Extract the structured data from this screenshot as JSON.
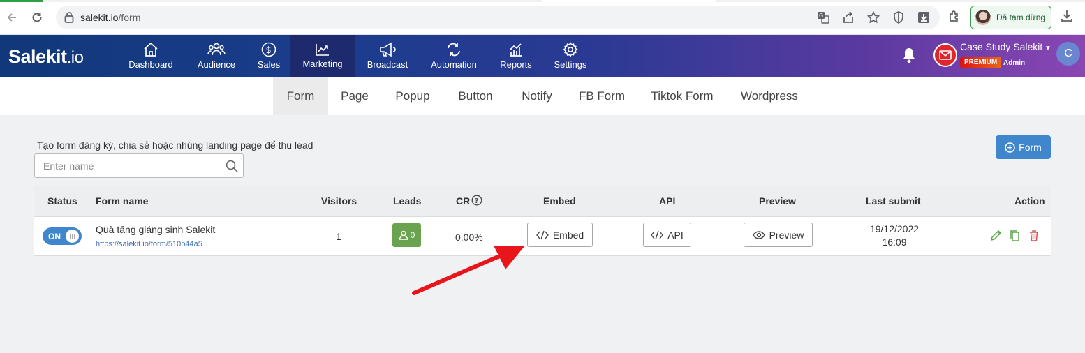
{
  "browser": {
    "url_host": "salekit.io",
    "url_path": "/form",
    "profile_status": "Đã tạm dừng"
  },
  "header": {
    "logo_main": "Salekit",
    "logo_suffix": ".io",
    "nav": [
      {
        "label": "Dashboard",
        "icon": "home-icon"
      },
      {
        "label": "Audience",
        "icon": "users-icon"
      },
      {
        "label": "Sales",
        "icon": "dollar-icon"
      },
      {
        "label": "Marketing",
        "icon": "chart-line-icon",
        "active": true
      },
      {
        "label": "Broadcast",
        "icon": "megaphone-icon"
      },
      {
        "label": "Automation",
        "icon": "repeat-icon"
      },
      {
        "label": "Reports",
        "icon": "bar-chart-icon"
      },
      {
        "label": "Settings",
        "icon": "gear-icon"
      }
    ],
    "account_name": "Case Study Salekit",
    "plan_badge": "PREMIUM",
    "role": "Admin",
    "avatar_letter": "C"
  },
  "subtabs": [
    "Form",
    "Page",
    "Popup",
    "Button",
    "Notify",
    "FB Form",
    "Tiktok Form",
    "Wordpress"
  ],
  "content": {
    "description": "Tạo form đăng ký, chia sẻ hoặc nhúng landing page để thu lead",
    "search_placeholder": "Enter name",
    "add_button_label": "Form"
  },
  "table": {
    "columns": [
      "Status",
      "Form name",
      "Visitors",
      "Leads",
      "CR",
      "Embed",
      "API",
      "Preview",
      "Last submit",
      "Action"
    ],
    "rows": [
      {
        "status": "ON",
        "name": "Quà tặng giáng sinh Salekit",
        "url": "https://salekit.io/form/510b44a5",
        "visitors": "1",
        "leads": "0",
        "cr": "0.00%",
        "embed_label": "Embed",
        "api_label": "API",
        "preview_label": "Preview",
        "last_submit_date": "19/12/2022",
        "last_submit_time": "16:09"
      }
    ]
  },
  "colors": {
    "primary": "#3f86cc",
    "leads_badge": "#6aa34f",
    "annotation_arrow": "#e8161b",
    "edit_icon": "#5aa64b",
    "delete_icon": "#d9534f"
  }
}
